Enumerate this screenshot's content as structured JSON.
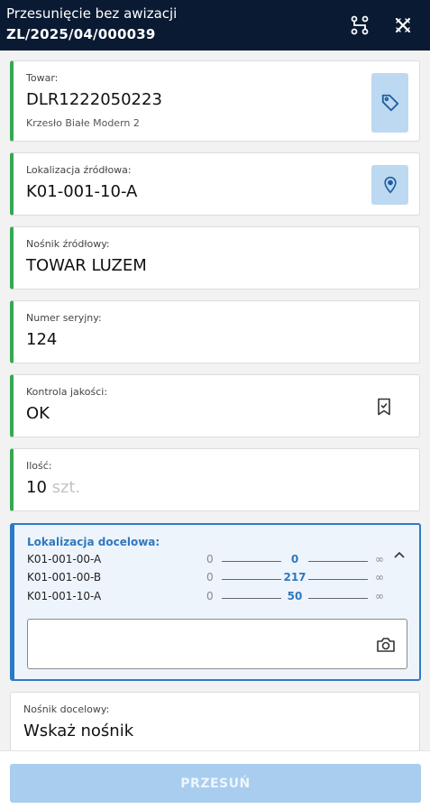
{
  "header": {
    "title": "Przesunięcie bez awizacji",
    "doc_number": "ZL/2025/04/000039",
    "icons": [
      "route-icon",
      "close-icon"
    ]
  },
  "fields": {
    "product": {
      "label": "Towar:",
      "value": "DLR1222050223",
      "description": "Krzesło Białe Modern 2",
      "icon": "tag-icon"
    },
    "source_location": {
      "label": "Lokalizacja źródłowa:",
      "value": "K01-001-10-A",
      "icon": "location-pin-icon"
    },
    "source_carrier": {
      "label": "Nośnik źródłowy:",
      "value": "TOWAR LUZEM"
    },
    "serial_number": {
      "label": "Numer seryjny:",
      "value": "124"
    },
    "quality_control": {
      "label": "Kontrola jakości:",
      "value": "OK",
      "icon": "bookmark-check-icon"
    },
    "quantity": {
      "label": "Ilość:",
      "value": "10",
      "unit": "szt."
    }
  },
  "destination": {
    "label": "Lokalizacja docelowa:",
    "rows": [
      {
        "location": "K01-001-00-A",
        "min": "0",
        "value": "0",
        "max": "∞"
      },
      {
        "location": "K01-001-00-B",
        "min": "0",
        "value": "217",
        "max": "∞"
      },
      {
        "location": "K01-001-10-A",
        "min": "0",
        "value": "50",
        "max": "∞"
      }
    ],
    "scan_input": {
      "value": "",
      "placeholder": ""
    },
    "icons": [
      "chevron-up-icon",
      "camera-icon"
    ]
  },
  "target_carrier": {
    "label": "Nośnik docelowy:",
    "value": "Wskaż nośnik"
  },
  "action": {
    "label": "PRZESUŃ"
  },
  "colors": {
    "header_bg": "#0a1a33",
    "accent_green": "#36a852",
    "accent_blue": "#2a7bc7",
    "button_disabled": "#a9cdef"
  }
}
